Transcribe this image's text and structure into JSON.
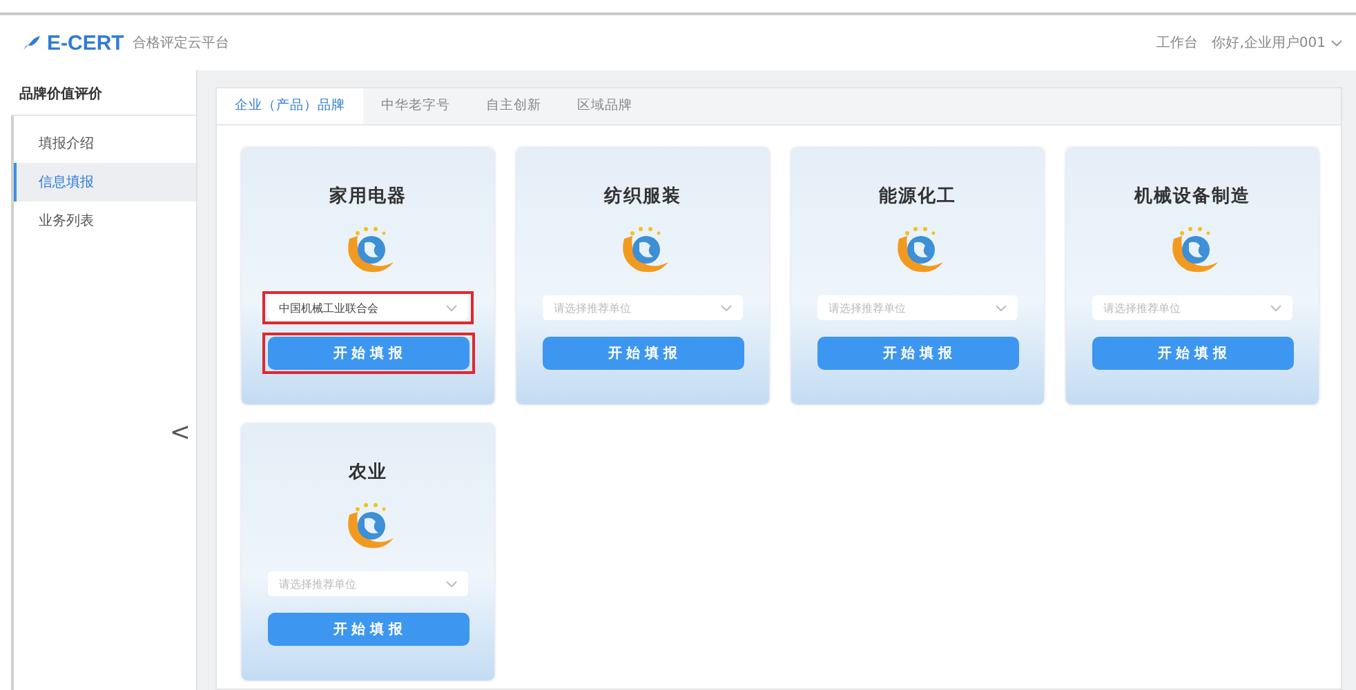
{
  "header": {
    "brand": "E-CERT",
    "subtitle": "合格评定云平台",
    "links": [
      {
        "label": "工作台"
      },
      {
        "label": "你好,企业用户001"
      }
    ]
  },
  "sidebar": {
    "title": "品牌价值评价",
    "items": [
      {
        "label": "填报介绍",
        "selected": false
      },
      {
        "label": "信息填报",
        "selected": true
      },
      {
        "label": "业务列表",
        "selected": false
      }
    ],
    "collapse": "<"
  },
  "tabs": [
    {
      "label": "企业（产品）品牌",
      "selected": true
    },
    {
      "label": "中华老字号",
      "selected": false
    },
    {
      "label": "自主创新",
      "selected": false
    },
    {
      "label": "区域品牌",
      "selected": false
    }
  ],
  "cards": [
    {
      "title": "家用电器",
      "select": {
        "value": "中国机械工业联合会"
      },
      "button": "开 始 填 报",
      "highlighted": true
    },
    {
      "title": "纺织服装",
      "select": {
        "placeholder": "请选择推荐单位"
      },
      "button": "开 始 填 报",
      "highlighted": false
    },
    {
      "title": "能源化工",
      "select": {
        "placeholder": "请选择推荐单位"
      },
      "button": "开 始 填 报",
      "highlighted": false
    },
    {
      "title": "机械设备制造",
      "select": {
        "placeholder": "请选择推荐单位"
      },
      "button": "开 始 填 报",
      "highlighted": false
    },
    {
      "title": "农业",
      "select": {
        "placeholder": "请选择推荐单位"
      },
      "button": "开 始 填 报",
      "highlighted": false
    }
  ]
}
